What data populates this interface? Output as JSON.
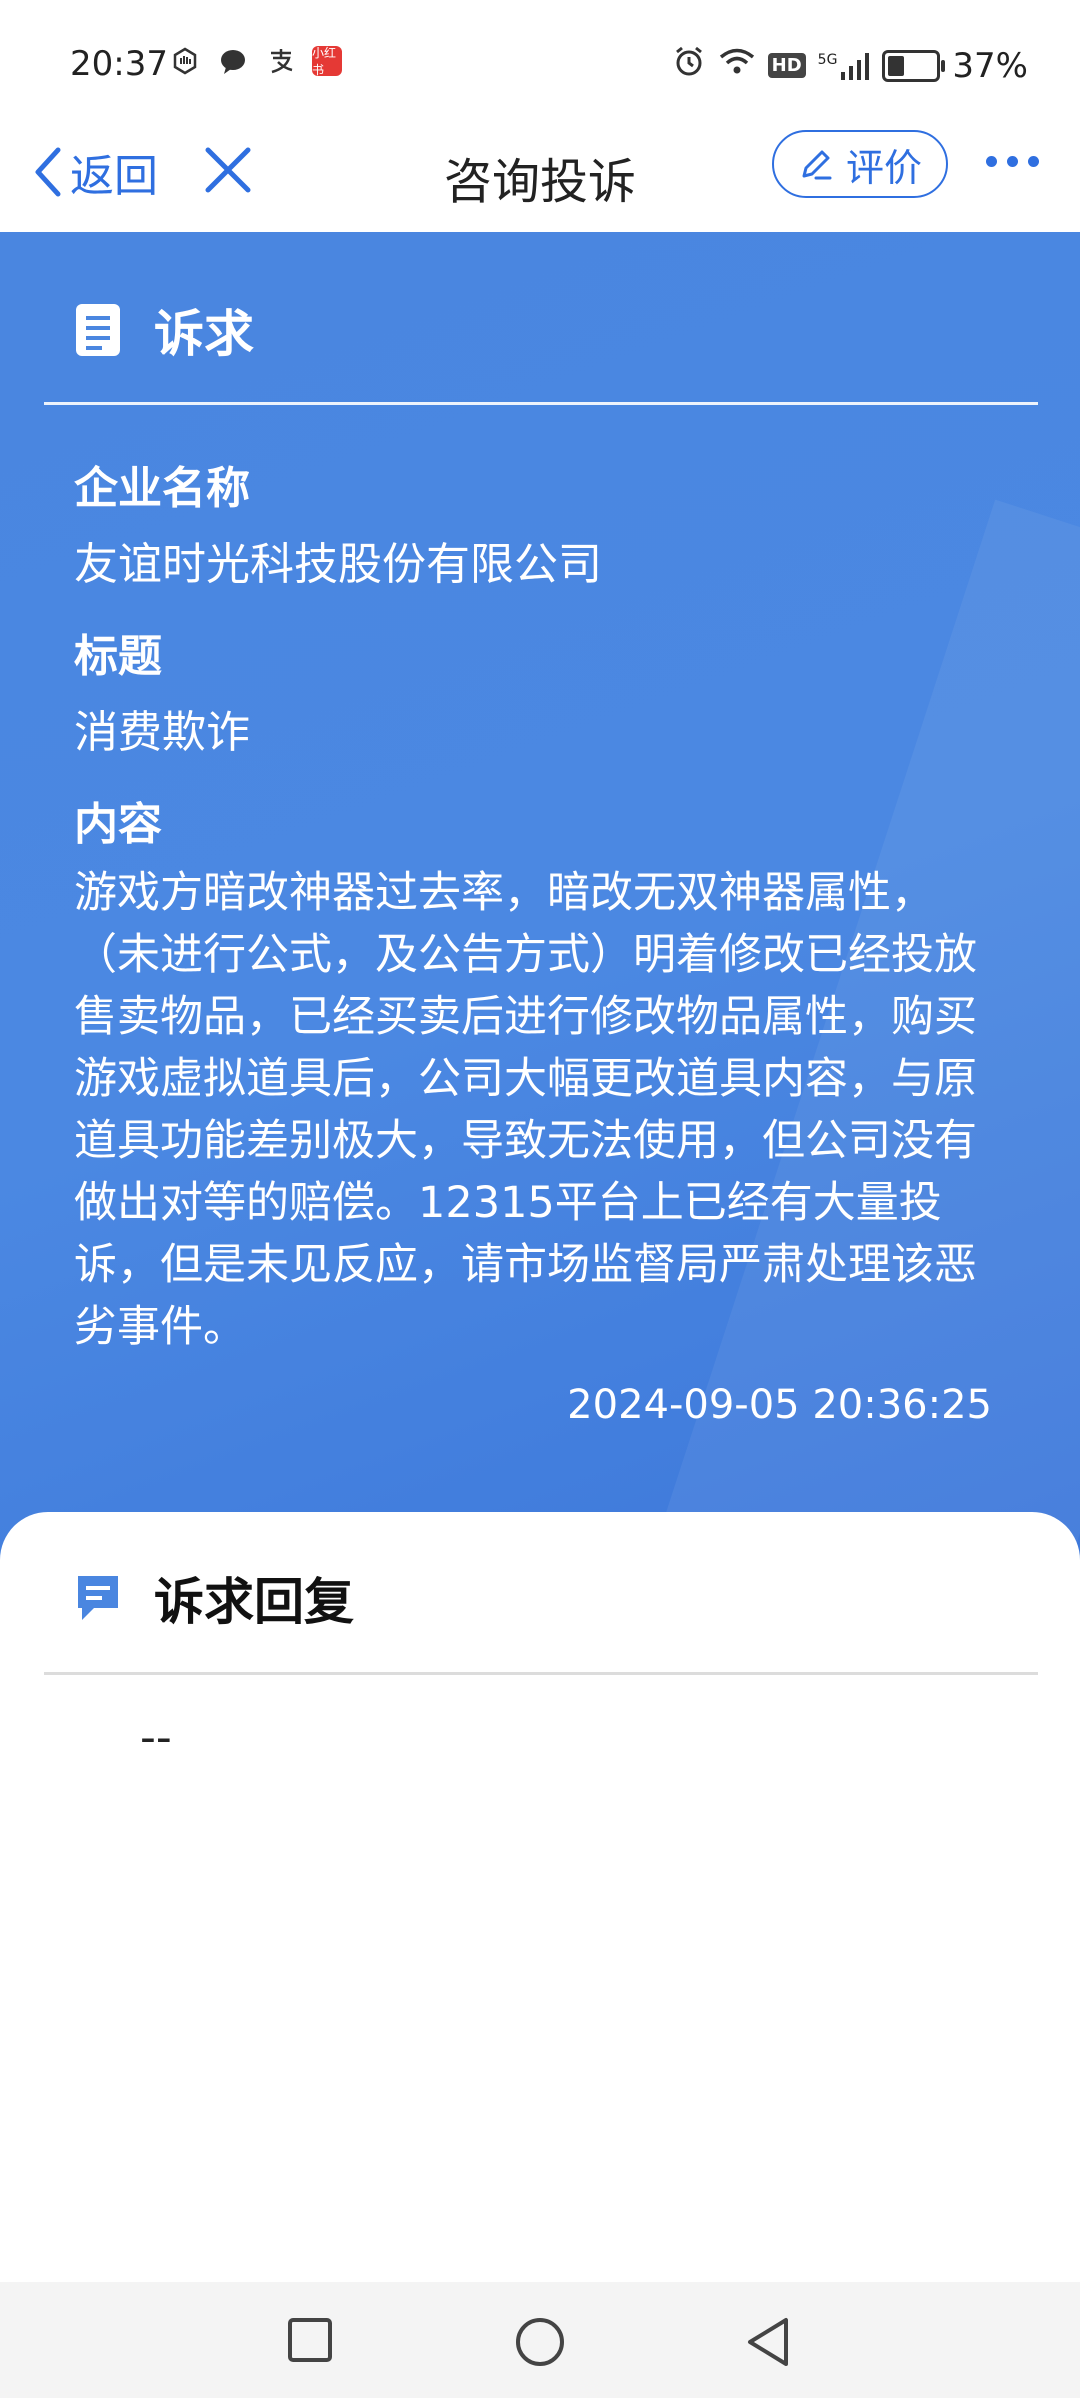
{
  "status_bar": {
    "time": "20:37",
    "left_icons": [
      "hand-icon",
      "chat-icon",
      "alipay-icon",
      "red-app-icon"
    ],
    "red_icon_text": "小红书",
    "hd": "HD",
    "network": "5G",
    "battery": "37%"
  },
  "nav": {
    "back_label": "返回",
    "title": "咨询投诉",
    "evaluate_label": "评价"
  },
  "appeal": {
    "section_title": "诉求",
    "company_label": "企业名称",
    "company_value": "友谊时光科技股份有限公司",
    "title_label": "标题",
    "title_value": "消费欺诈",
    "content_label": "内容",
    "content_value": "游戏方暗改神器过去率，暗改无双神器属性，（未进行公式，及公告方式）明着修改已经投放售卖物品，已经买卖后进行修改物品属性，购买游戏虚拟道具后，公司大幅更改道具内容，与原道具功能差别极大，导致无法使用，但公司没有做出对等的赔偿。12315平台上已经有大量投诉，但是未见反应，请市场监督局严肃处理该恶劣事件。",
    "timestamp": "2024-09-05 20:36:25"
  },
  "reply": {
    "section_title": "诉求回复",
    "value": "--"
  },
  "colors": {
    "accent": "#2f6fe0",
    "panel": "#4a86e0"
  }
}
